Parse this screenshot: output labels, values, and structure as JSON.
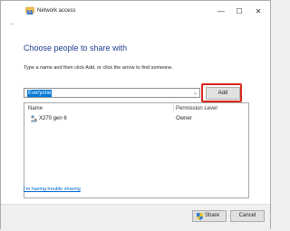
{
  "window": {
    "title": "Network access",
    "title_icon": "network-users-icon",
    "controls": {
      "minimize_glyph": "—",
      "maximize_glyph": "☐",
      "close_glyph": "✕"
    },
    "back_glyph": "←"
  },
  "main": {
    "heading": "Choose people to share with",
    "instruction": "Type a name and then click Add, or click the arrow to find someone.",
    "name_input": {
      "value": "Everyone",
      "arrow_glyph": "⌄"
    },
    "add_label": "Add",
    "highlight_color": "#d9261c",
    "list": {
      "columns": [
        "Name",
        "Permission Level"
      ],
      "rows": [
        {
          "name": "X270 gen 6",
          "permission": "Owner",
          "icon": "user-icon"
        }
      ]
    },
    "trouble_link": "I'm having trouble sharing"
  },
  "footer": {
    "share_label": "Share",
    "share_icon": "shield-icon",
    "cancel_label": "Cancel"
  },
  "colors": {
    "heading": "#1b3d8f",
    "selection": "#0078d7",
    "link": "#0066cc"
  }
}
